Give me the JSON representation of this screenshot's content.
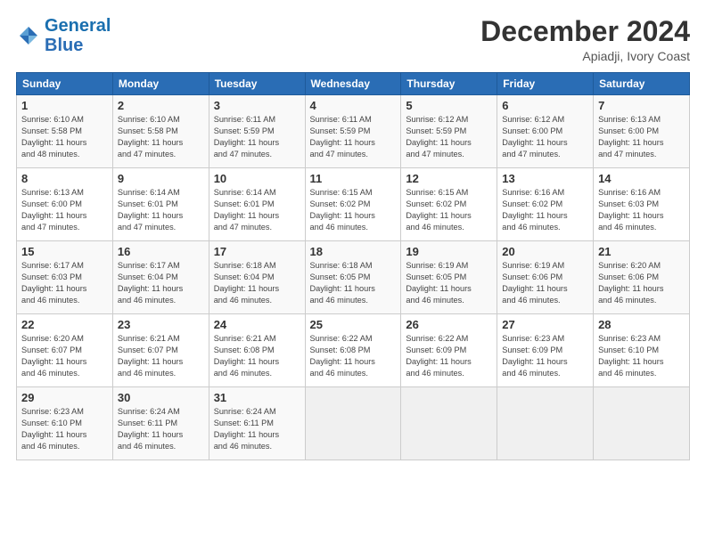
{
  "logo": {
    "line1": "General",
    "line2": "Blue"
  },
  "header": {
    "month": "December 2024",
    "location": "Apiadji, Ivory Coast"
  },
  "weekdays": [
    "Sunday",
    "Monday",
    "Tuesday",
    "Wednesday",
    "Thursday",
    "Friday",
    "Saturday"
  ],
  "weeks": [
    [
      {
        "day": "1",
        "info": "Sunrise: 6:10 AM\nSunset: 5:58 PM\nDaylight: 11 hours\nand 48 minutes."
      },
      {
        "day": "2",
        "info": "Sunrise: 6:10 AM\nSunset: 5:58 PM\nDaylight: 11 hours\nand 47 minutes."
      },
      {
        "day": "3",
        "info": "Sunrise: 6:11 AM\nSunset: 5:59 PM\nDaylight: 11 hours\nand 47 minutes."
      },
      {
        "day": "4",
        "info": "Sunrise: 6:11 AM\nSunset: 5:59 PM\nDaylight: 11 hours\nand 47 minutes."
      },
      {
        "day": "5",
        "info": "Sunrise: 6:12 AM\nSunset: 5:59 PM\nDaylight: 11 hours\nand 47 minutes."
      },
      {
        "day": "6",
        "info": "Sunrise: 6:12 AM\nSunset: 6:00 PM\nDaylight: 11 hours\nand 47 minutes."
      },
      {
        "day": "7",
        "info": "Sunrise: 6:13 AM\nSunset: 6:00 PM\nDaylight: 11 hours\nand 47 minutes."
      }
    ],
    [
      {
        "day": "8",
        "info": "Sunrise: 6:13 AM\nSunset: 6:00 PM\nDaylight: 11 hours\nand 47 minutes."
      },
      {
        "day": "9",
        "info": "Sunrise: 6:14 AM\nSunset: 6:01 PM\nDaylight: 11 hours\nand 47 minutes."
      },
      {
        "day": "10",
        "info": "Sunrise: 6:14 AM\nSunset: 6:01 PM\nDaylight: 11 hours\nand 47 minutes."
      },
      {
        "day": "11",
        "info": "Sunrise: 6:15 AM\nSunset: 6:02 PM\nDaylight: 11 hours\nand 46 minutes."
      },
      {
        "day": "12",
        "info": "Sunrise: 6:15 AM\nSunset: 6:02 PM\nDaylight: 11 hours\nand 46 minutes."
      },
      {
        "day": "13",
        "info": "Sunrise: 6:16 AM\nSunset: 6:02 PM\nDaylight: 11 hours\nand 46 minutes."
      },
      {
        "day": "14",
        "info": "Sunrise: 6:16 AM\nSunset: 6:03 PM\nDaylight: 11 hours\nand 46 minutes."
      }
    ],
    [
      {
        "day": "15",
        "info": "Sunrise: 6:17 AM\nSunset: 6:03 PM\nDaylight: 11 hours\nand 46 minutes."
      },
      {
        "day": "16",
        "info": "Sunrise: 6:17 AM\nSunset: 6:04 PM\nDaylight: 11 hours\nand 46 minutes."
      },
      {
        "day": "17",
        "info": "Sunrise: 6:18 AM\nSunset: 6:04 PM\nDaylight: 11 hours\nand 46 minutes."
      },
      {
        "day": "18",
        "info": "Sunrise: 6:18 AM\nSunset: 6:05 PM\nDaylight: 11 hours\nand 46 minutes."
      },
      {
        "day": "19",
        "info": "Sunrise: 6:19 AM\nSunset: 6:05 PM\nDaylight: 11 hours\nand 46 minutes."
      },
      {
        "day": "20",
        "info": "Sunrise: 6:19 AM\nSunset: 6:06 PM\nDaylight: 11 hours\nand 46 minutes."
      },
      {
        "day": "21",
        "info": "Sunrise: 6:20 AM\nSunset: 6:06 PM\nDaylight: 11 hours\nand 46 minutes."
      }
    ],
    [
      {
        "day": "22",
        "info": "Sunrise: 6:20 AM\nSunset: 6:07 PM\nDaylight: 11 hours\nand 46 minutes."
      },
      {
        "day": "23",
        "info": "Sunrise: 6:21 AM\nSunset: 6:07 PM\nDaylight: 11 hours\nand 46 minutes."
      },
      {
        "day": "24",
        "info": "Sunrise: 6:21 AM\nSunset: 6:08 PM\nDaylight: 11 hours\nand 46 minutes."
      },
      {
        "day": "25",
        "info": "Sunrise: 6:22 AM\nSunset: 6:08 PM\nDaylight: 11 hours\nand 46 minutes."
      },
      {
        "day": "26",
        "info": "Sunrise: 6:22 AM\nSunset: 6:09 PM\nDaylight: 11 hours\nand 46 minutes."
      },
      {
        "day": "27",
        "info": "Sunrise: 6:23 AM\nSunset: 6:09 PM\nDaylight: 11 hours\nand 46 minutes."
      },
      {
        "day": "28",
        "info": "Sunrise: 6:23 AM\nSunset: 6:10 PM\nDaylight: 11 hours\nand 46 minutes."
      }
    ],
    [
      {
        "day": "29",
        "info": "Sunrise: 6:23 AM\nSunset: 6:10 PM\nDaylight: 11 hours\nand 46 minutes."
      },
      {
        "day": "30",
        "info": "Sunrise: 6:24 AM\nSunset: 6:11 PM\nDaylight: 11 hours\nand 46 minutes."
      },
      {
        "day": "31",
        "info": "Sunrise: 6:24 AM\nSunset: 6:11 PM\nDaylight: 11 hours\nand 46 minutes."
      },
      null,
      null,
      null,
      null
    ]
  ]
}
